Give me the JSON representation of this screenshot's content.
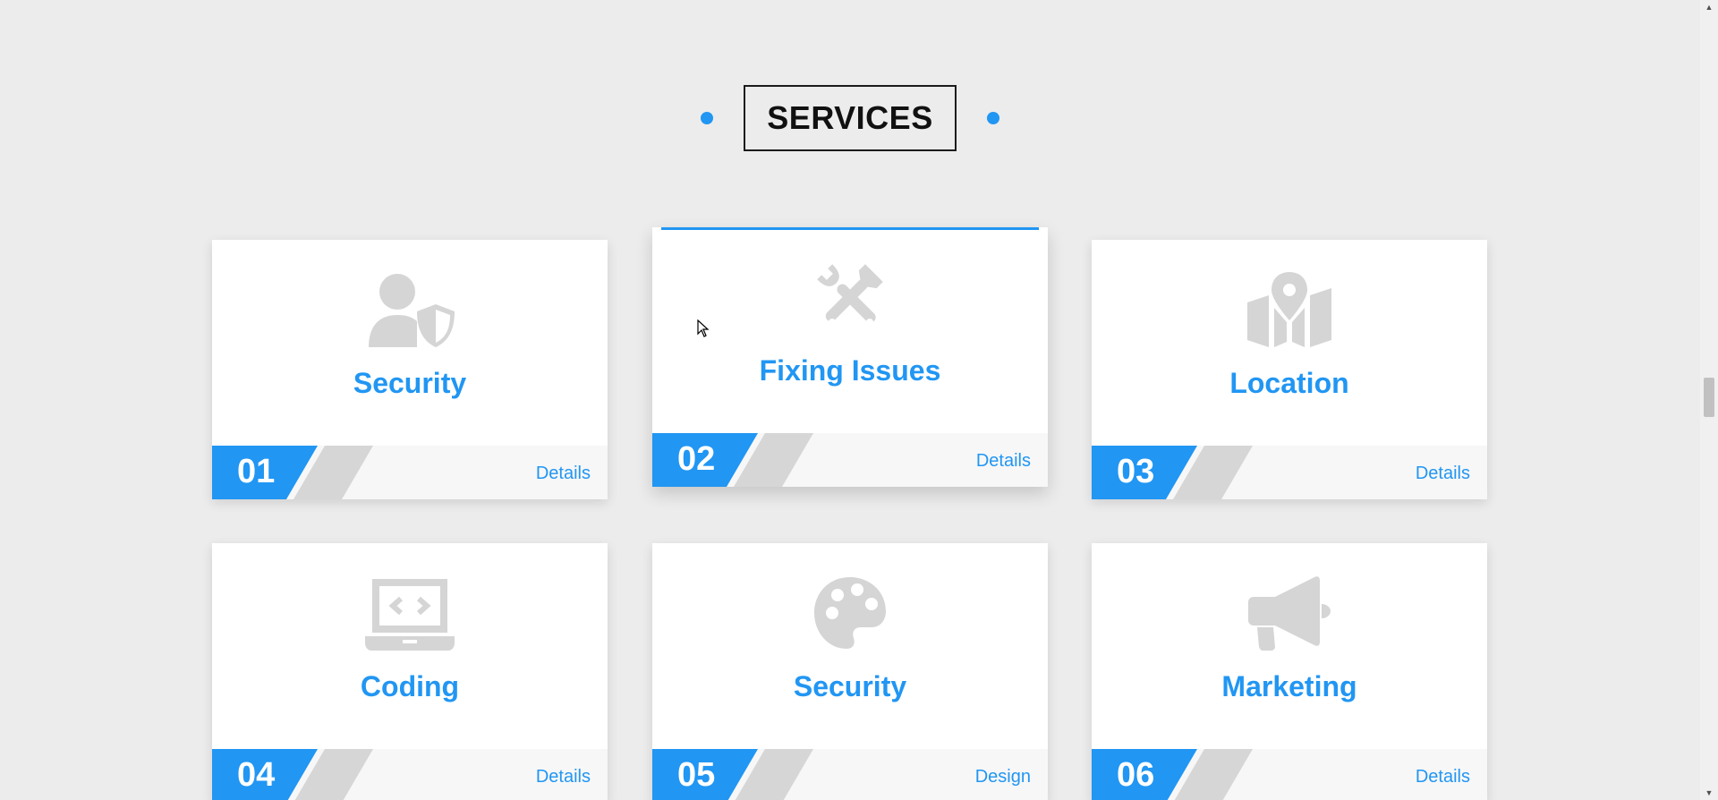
{
  "section": {
    "title": "SERVICES"
  },
  "cards": [
    {
      "number": "01",
      "title": "Security",
      "link": "Details",
      "icon": "user-shield-icon"
    },
    {
      "number": "02",
      "title": "Fixing Issues",
      "link": "Details",
      "icon": "tools-icon"
    },
    {
      "number": "03",
      "title": "Location",
      "link": "Details",
      "icon": "map-location-icon"
    },
    {
      "number": "04",
      "title": "Coding",
      "link": "Details",
      "icon": "laptop-code-icon"
    },
    {
      "number": "05",
      "title": "Security",
      "link": "Design",
      "icon": "palette-icon"
    },
    {
      "number": "06",
      "title": "Marketing",
      "link": "Details",
      "icon": "bullhorn-icon"
    }
  ],
  "colors": {
    "accent": "#2196f3",
    "background": "#ececec",
    "icon": "#d5d5d5",
    "stripe": "#d6d6d6",
    "footer": "#f7f7f7"
  },
  "scrollbar": {
    "up_arrow": "▲",
    "down_arrow": "▼"
  }
}
